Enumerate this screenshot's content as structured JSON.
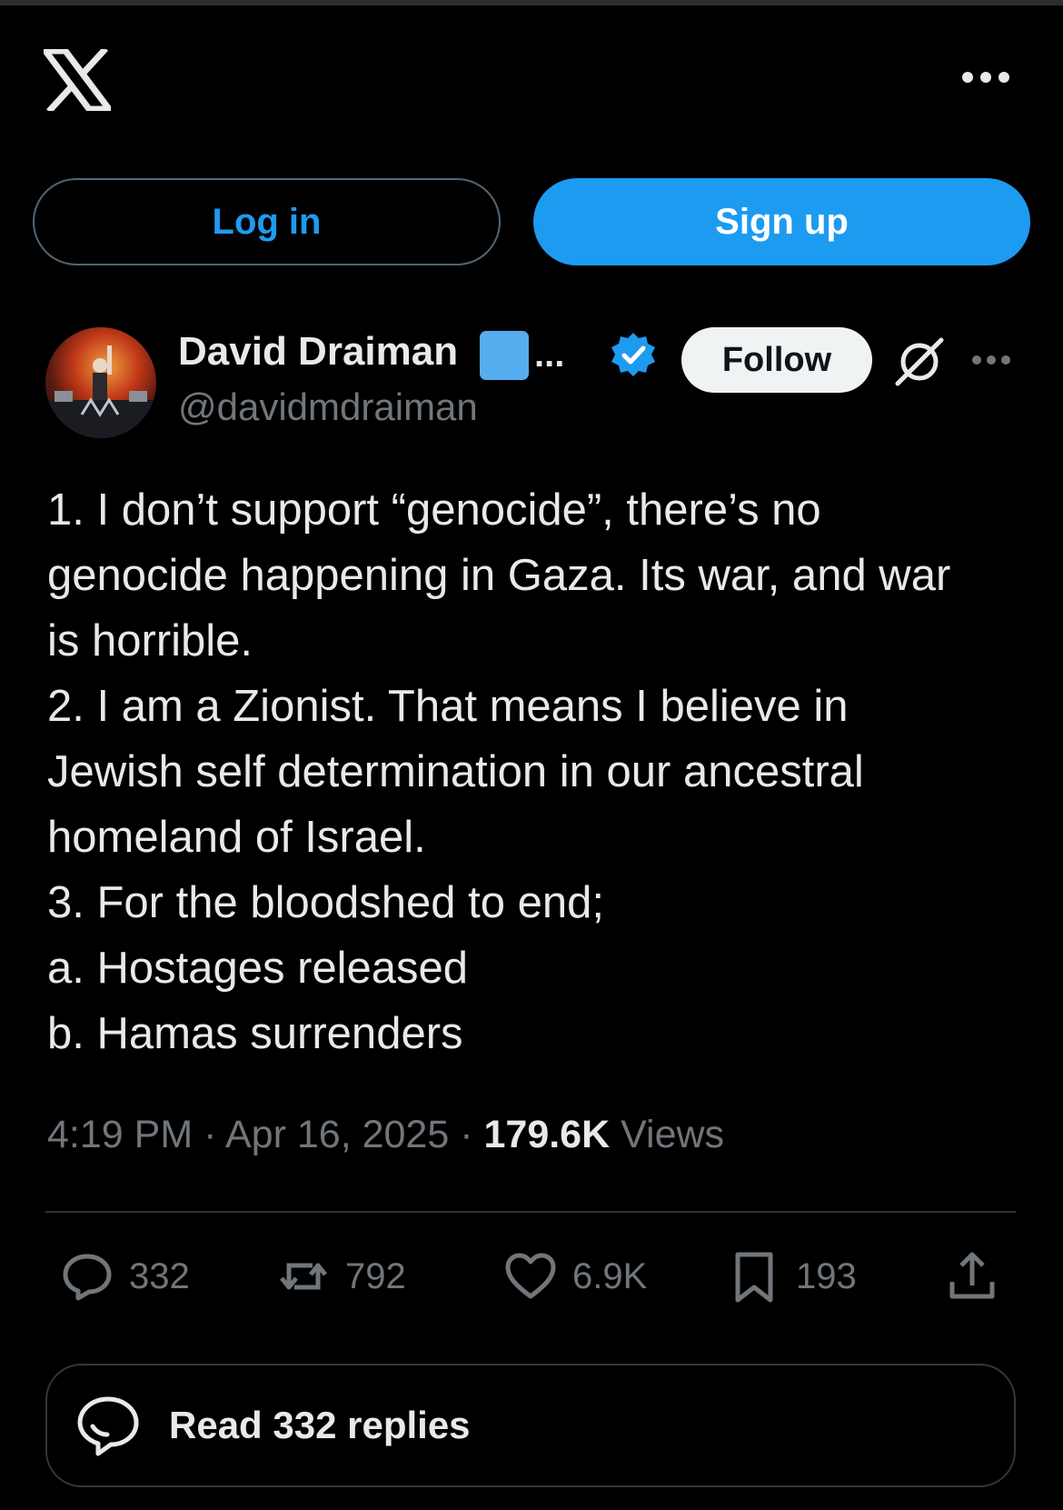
{
  "app": {
    "logo_icon": "x-logo-icon",
    "more_icon": "more-horizontal-icon"
  },
  "auth": {
    "login_label": "Log in",
    "signup_label": "Sign up"
  },
  "post": {
    "author": {
      "name": "David Draiman",
      "name_suffix": "...",
      "handle": "@davidmdraiman",
      "verified": true,
      "avatar_icon": "avatar-image"
    },
    "follow_label": "Follow",
    "lines": [
      "1. I don’t support “genocide”, there’s no",
      "genocide happening in Gaza. Its war, and war",
      "is horrible.",
      "2. I am a Zionist. That means I believe in",
      "Jewish self determination in our ancestral",
      "homeland of Israel.",
      "3. For the bloodshed to end;",
      "a. Hostages released",
      "b. Hamas surrenders"
    ],
    "time": "4:19 PM",
    "date": "Apr 16, 2025",
    "separator": "·",
    "views_count": "179.6K",
    "views_label": "Views",
    "stats": {
      "replies": "332",
      "reposts": "792",
      "likes": "6.9K",
      "bookmarks": "193"
    },
    "read_replies_label": "Read 332 replies"
  },
  "colors": {
    "background": "#000000",
    "accent": "#1d9bf0",
    "text_primary": "#e7e9ea",
    "text_secondary": "#71767b",
    "border": "#2f3336"
  }
}
